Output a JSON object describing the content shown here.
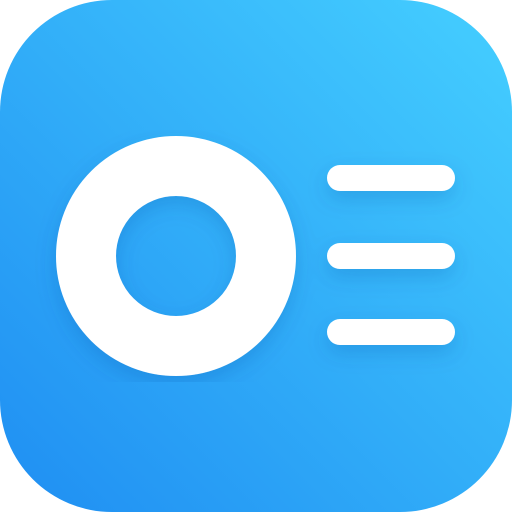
{
  "app_icon": {
    "icon": "circle-and-list-icon",
    "colors": {
      "gradient_start": "#1f8ef2",
      "gradient_end": "#45cfff",
      "glyph": "#ffffff"
    }
  }
}
